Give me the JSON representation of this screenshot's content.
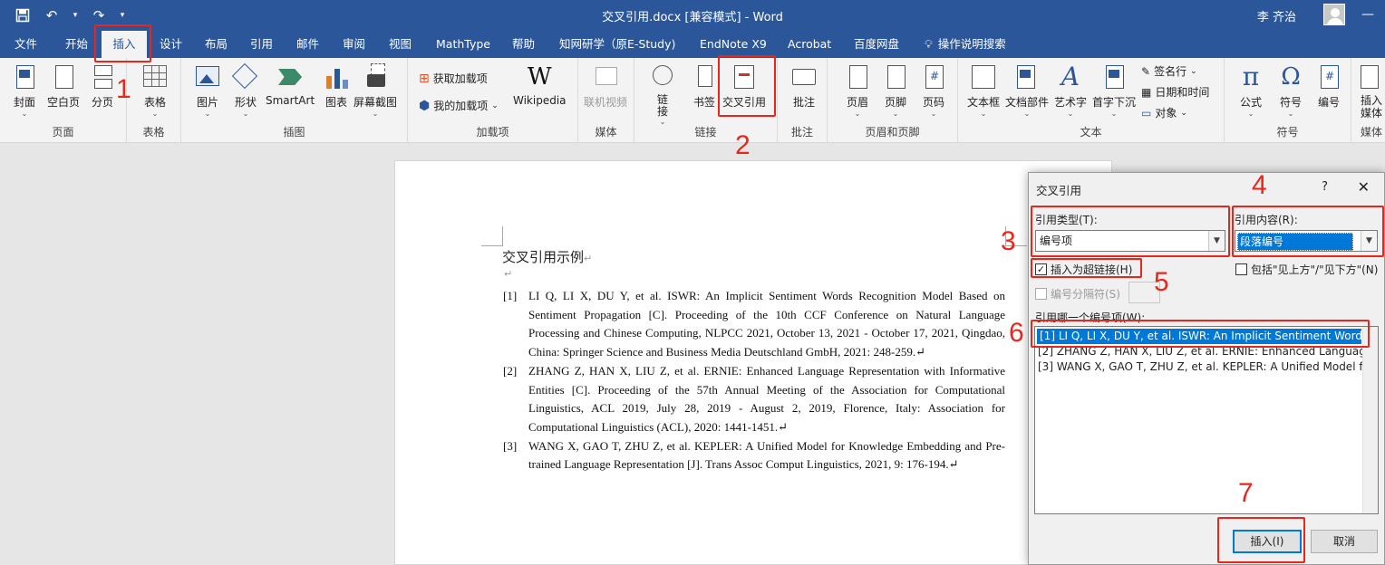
{
  "window": {
    "title": "交叉引用.docx [兼容模式] - Word",
    "user": "李 齐治"
  },
  "tabs": [
    "文件",
    "开始",
    "插入",
    "设计",
    "布局",
    "引用",
    "邮件",
    "审阅",
    "视图",
    "MathType",
    "帮助",
    "知网研学（原E-Study)",
    "EndNote X9",
    "Acrobat",
    "百度网盘",
    "操作说明搜索"
  ],
  "ribbon": {
    "pages": {
      "label": "页面",
      "cover": "封面",
      "blank": "空白页",
      "break": "分页"
    },
    "tables": {
      "label": "表格",
      "table": "表格"
    },
    "illustrations": {
      "label": "插图",
      "picture": "图片",
      "shapes": "形状",
      "smartart": "SmartArt",
      "chart": "图表",
      "screenshot": "屏幕截图"
    },
    "addins": {
      "label": "加载项",
      "get": "获取加载项",
      "mine": "我的加载项",
      "wikipedia": "Wikipedia",
      "wiki_glyph": "W"
    },
    "media": {
      "label": "媒体",
      "online_video": "联机视频"
    },
    "links": {
      "label": "链接",
      "link": "链\n接",
      "bookmark": "书签",
      "crossref": "交叉引用"
    },
    "comments": {
      "label": "批注",
      "comment": "批注"
    },
    "header_footer": {
      "label": "页眉和页脚",
      "header": "页眉",
      "footer": "页脚",
      "page_number": "页码",
      "page_glyph": "#"
    },
    "text": {
      "label": "文本",
      "textbox": "文本框",
      "quickparts": "文档部件",
      "wordart": "艺术字",
      "dropcap": "首字下沉",
      "signature": "签名行",
      "datetime": "日期和时间",
      "object": "对象",
      "wordart_glyph": "A"
    },
    "symbols": {
      "label": "符号",
      "equation": "公式",
      "symbol": "符号",
      "numbering": "编号",
      "pi_glyph": "π",
      "omega_glyph": "Ω",
      "number_glyph": "#"
    },
    "media2": {
      "label": "媒体",
      "insert_media": "插入媒体"
    }
  },
  "document": {
    "title": "交叉引用示例",
    "pilcrow": "↵",
    "references": [
      {
        "num": "[1]",
        "text": "LI Q, LI X, DU Y, et al. ISWR: An Implicit Sentiment Words Recognition Model Based on Sentiment Propagation [C]. Proceeding of the 10th CCF Conference on Natural Language Processing and Chinese Computing, NLPCC 2021, October 13, 2021 - October 17, 2021, Qingdao, China: Springer Science and Business Media Deutschland GmbH, 2021: 248-259.↵"
      },
      {
        "num": "[2]",
        "text": "ZHANG Z, HAN X, LIU Z, et al. ERNIE: Enhanced Language Representation with Informative Entities [C]. Proceeding of the 57th Annual Meeting of the Association for Computational Linguistics, ACL 2019, July 28, 2019 - August 2, 2019, Florence, Italy: Association for Computational Linguistics (ACL), 2020: 1441-1451.↵"
      },
      {
        "num": "[3]",
        "text": "WANG X, GAO T, ZHU Z, et al. KEPLER: A Unified Model for Knowledge Embedding and Pre-trained Language Representation [J]. Trans Assoc Comput Linguistics, 2021, 9: 176-194.↵"
      }
    ]
  },
  "dialog": {
    "title": "交叉引用",
    "help": "?",
    "close": "✕",
    "ref_type_label": "引用类型(T):",
    "ref_type_value": "编号项",
    "ref_content_label": "引用内容(R):",
    "ref_content_value": "段落编号",
    "hyperlink_label": "插入为超链接(H)",
    "hyperlink_checked": "✓",
    "above_below_label": "包括\"见上方\"/\"见下方\"(N)",
    "separator_label": "编号分隔符(S)",
    "list_label": "引用哪一个编号项(W):",
    "items": [
      "[1] LI Q, LI X, DU Y, et al. ISWR: An Implicit Sentiment Words...",
      "[2] ZHANG Z, HAN X, LIU Z, et al. ERNIE: Enhanced Languag...",
      "[3] WANG X, GAO T, ZHU Z, et al. KEPLER: A Unified Model f..."
    ],
    "insert_button": "插入(I)",
    "cancel_button": "取消"
  },
  "annotations": [
    "1",
    "2",
    "3",
    "4",
    "5",
    "6",
    "7"
  ],
  "colors": {
    "word_blue": "#2b579a",
    "annotation_red": "#e8261c",
    "selection_blue": "#0078d7"
  }
}
